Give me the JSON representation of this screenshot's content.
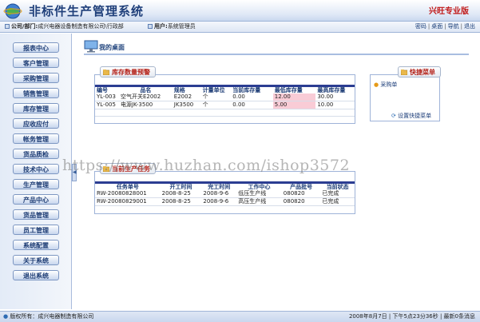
{
  "app": {
    "title": "非标件生产管理系统",
    "edition": "兴旺专业版"
  },
  "infobar": {
    "company_label": "公司/部门:",
    "company_value": "成兴电器设备制造有限公司\\行政部",
    "user_label": "用户:",
    "user_value": "系统管理员",
    "links": [
      "密码",
      "桌面",
      "导航",
      "退出"
    ]
  },
  "sidebar": {
    "items": [
      "报表中心",
      "客户管理",
      "采购管理",
      "销售管理",
      "库存管理",
      "应收应付",
      "帐务管理",
      "货品质检",
      "技术中心",
      "生产管理",
      "产品中心",
      "货品管理",
      "员工管理",
      "系统配置",
      "关于系统",
      "退出系统"
    ]
  },
  "main": {
    "title": "我的桌面",
    "stock_panel": {
      "tag": "库存数量预警",
      "columns": [
        "编号",
        "品名",
        "规格",
        "计量单位",
        "当前库存量",
        "最低库存量",
        "最高库存量"
      ],
      "rows": [
        [
          "YL-003",
          "空气开关E2002",
          "E2002",
          "个",
          "0.00",
          "12.00",
          "30.00"
        ],
        [
          "YL-005",
          "电源JK-3500",
          "JK3500",
          "个",
          "0.00",
          "5.00",
          "10.00"
        ]
      ]
    },
    "quick_panel": {
      "tag": "快捷菜单",
      "item": "采购单",
      "settings": "设置快捷菜单"
    },
    "production_panel": {
      "tag": "当前生产任务",
      "columns": [
        "任务单号",
        "开工时间",
        "完工时间",
        "工作中心",
        "产品批号",
        "当前状态"
      ],
      "rows": [
        [
          "RW-20080828001",
          "2008-8-25",
          "2008-9-6",
          "低压生产线",
          "080820",
          "已完成"
        ],
        [
          "RW-20080829001",
          "2008-8-25",
          "2008-9-6",
          "高压生产线",
          "080820",
          "已完成"
        ]
      ]
    }
  },
  "watermark": "https://www.huzhan.com/ishop3572",
  "status": {
    "left": "版权所有：成兴电器制造有限公司",
    "right": "2008年8月7日 | 下午5点23分36秒 | 最新0条消息"
  },
  "colors": {
    "accent": "#1f3f7a",
    "edition": "#c01818",
    "header_band": "#2b3d92",
    "warning_cell": "#f9ccd6"
  }
}
